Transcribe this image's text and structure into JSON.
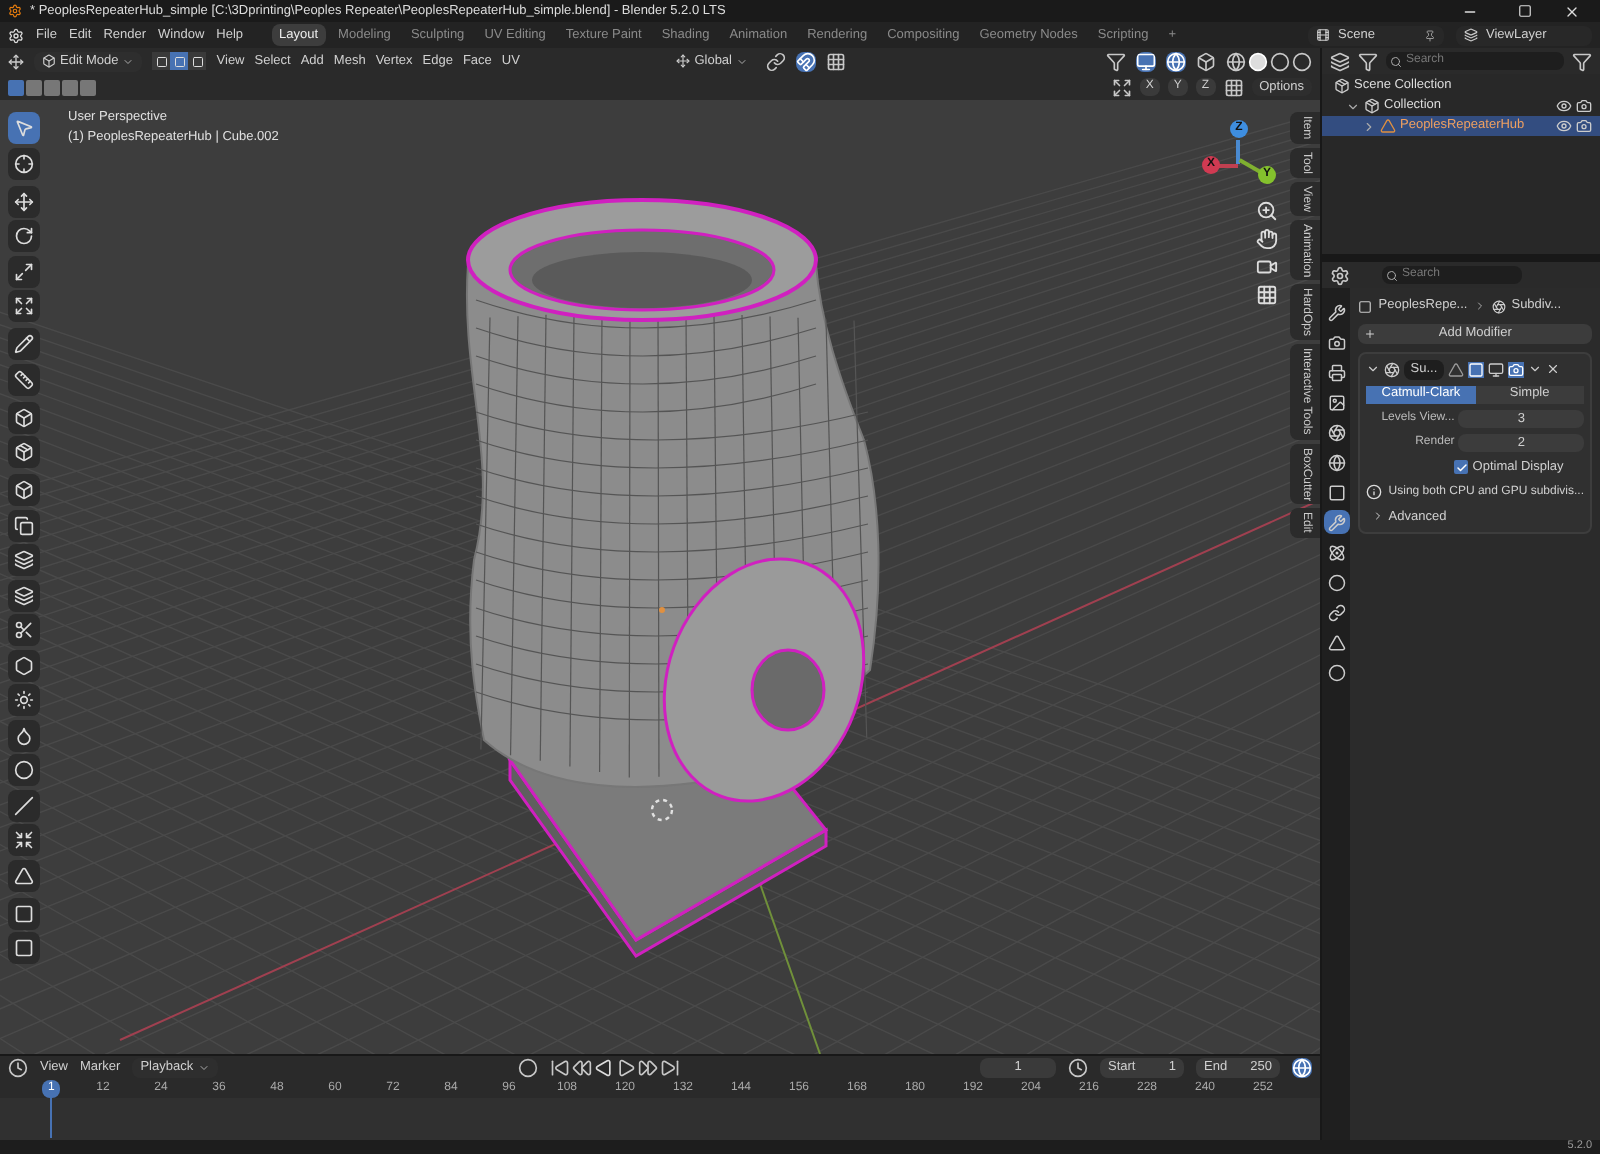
{
  "window": {
    "title": "* PeoplesRepeaterHub_simple [C:\\3Dprinting\\Peoples Repeater\\PeoplesRepeaterHub_simple.blend] - Blender 5.2.0 LTS"
  },
  "menu": [
    "File",
    "Edit",
    "Render",
    "Window",
    "Help"
  ],
  "workspaces": [
    {
      "label": "Layout",
      "selected": true
    },
    {
      "label": "Modeling",
      "selected": false
    },
    {
      "label": "Sculpting",
      "selected": false
    },
    {
      "label": "UV Editing",
      "selected": false
    },
    {
      "label": "Texture Paint",
      "selected": false
    },
    {
      "label": "Shading",
      "selected": false
    },
    {
      "label": "Animation",
      "selected": false
    },
    {
      "label": "Rendering",
      "selected": false
    },
    {
      "label": "Compositing",
      "selected": false
    },
    {
      "label": "Geometry Nodes",
      "selected": false
    },
    {
      "label": "Scripting",
      "selected": false
    },
    {
      "label": "+",
      "selected": false
    }
  ],
  "scene": "Scene",
  "view_layer": "ViewLayer",
  "viewport_header": {
    "mode": "Edit Mode",
    "select_modes": [
      {
        "selected": false
      },
      {
        "selected": true
      },
      {
        "selected": false
      }
    ],
    "menus": [
      "View",
      "Select",
      "Add",
      "Mesh",
      "Vertex",
      "Edge",
      "Face",
      "UV"
    ],
    "orientation": "Global",
    "axes": [
      "X",
      "Y",
      "Z"
    ],
    "options": "Options"
  },
  "viewport": {
    "view_name": "User Perspective",
    "object_info": "(1) PeoplesRepeaterHub | Cube.002",
    "gizmo_axes": [
      "X",
      "Y",
      "Z"
    ],
    "side_tabs": [
      "Item",
      "Tool",
      "View",
      "Animation",
      "HardOps",
      "Interactive Tools",
      "BoxCutter",
      "Edit"
    ]
  },
  "toolbar": {
    "groups": [
      {
        "tools": [
          {
            "selected": true
          },
          {
            "selected": false
          }
        ]
      },
      {
        "tools": [
          {
            "selected": false
          },
          {
            "selected": false
          },
          {
            "selected": false
          },
          {
            "selected": false
          }
        ]
      },
      {
        "tools": [
          {
            "selected": false
          },
          {
            "selected": false
          }
        ]
      },
      {
        "tools": [
          {
            "selected": false
          },
          {
            "selected": false
          }
        ]
      },
      {
        "tools": [
          {
            "selected": false
          },
          {
            "selected": false
          },
          {
            "selected": false
          },
          {
            "selected": false
          },
          {
            "selected": false
          },
          {
            "selected": false
          },
          {
            "selected": false
          },
          {
            "selected": false
          },
          {
            "selected": false
          },
          {
            "selected": false
          },
          {
            "selected": false
          },
          {
            "selected": false
          }
        ]
      },
      {
        "tools": [
          {
            "selected": false
          },
          {
            "selected": false
          }
        ]
      }
    ]
  },
  "outliner": {
    "search_placeholder": "Search",
    "items": [
      {
        "label": "Scene Collection",
        "selected": false,
        "children": [
          {
            "label": "Collection",
            "selected": false,
            "children": [
              {
                "label": "PeoplesRepeaterHub",
                "selected": true
              }
            ]
          }
        ]
      }
    ]
  },
  "properties": {
    "search_placeholder": "Search",
    "tabs": [
      {
        "selected": false
      },
      {
        "selected": false
      },
      {
        "selected": false
      },
      {
        "selected": false
      },
      {
        "selected": false
      },
      {
        "selected": false
      },
      {
        "selected": false
      },
      {
        "selected": true
      },
      {
        "selected": false
      },
      {
        "selected": false
      },
      {
        "selected": false
      },
      {
        "selected": false
      },
      {
        "selected": false
      }
    ],
    "breadcrumb": [
      "PeoplesRepe...",
      "Subdiv..."
    ],
    "add_modifier": "Add Modifier",
    "modifier": {
      "name": "Su...",
      "expanded": true,
      "methods": [
        {
          "label": "Catmull-Clark",
          "selected": true
        },
        {
          "label": "Simple",
          "selected": false
        }
      ],
      "fields": [
        {
          "label": "Levels View...",
          "value": "3"
        },
        {
          "label": "Render",
          "value": "2"
        }
      ],
      "optimal_display": {
        "label": "Optimal Display",
        "checked": true
      },
      "info": "Using both CPU and GPU subdivis...",
      "advanced": {
        "label": "Advanced",
        "expanded": false
      }
    }
  },
  "timeline": {
    "menus": [
      {
        "label": "View",
        "kind": "menu"
      },
      {
        "label": "Marker",
        "kind": "menu"
      },
      {
        "label": "Playback",
        "kind": "dropdown"
      }
    ],
    "current_frame": "1",
    "start_label": "Start",
    "start": "1",
    "end_label": "End",
    "end": "250",
    "playhead": "1",
    "ruler": [
      "12",
      "24",
      "36",
      "48",
      "60",
      "72",
      "84",
      "96",
      "108",
      "120",
      "132",
      "144",
      "156",
      "168",
      "180",
      "192",
      "204",
      "216",
      "228",
      "240",
      "252"
    ]
  },
  "status_bar": {
    "version": "5.2.0"
  }
}
